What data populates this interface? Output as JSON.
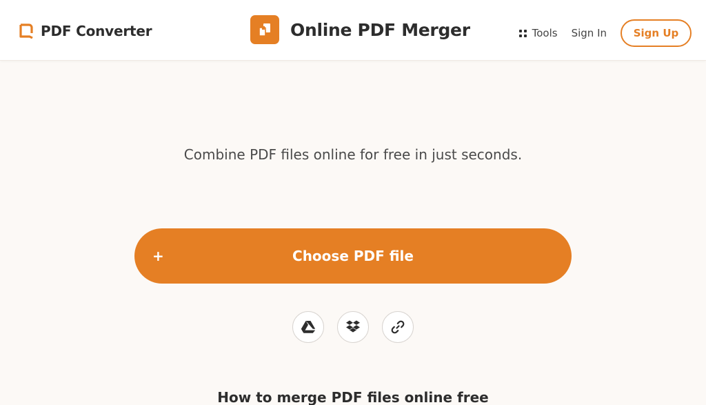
{
  "header": {
    "brand_name": "PDF Converter",
    "page_title": "Online PDF Merger",
    "nav": {
      "tools_label": "Tools",
      "signin_label": "Sign In",
      "signup_label": "Sign Up"
    }
  },
  "main": {
    "subtitle": "Combine PDF files online for free in just seconds.",
    "choose_button_label": "Choose PDF file",
    "choose_button_prefix": "+",
    "sources": [
      {
        "name": "google-drive",
        "icon": "google-drive-icon"
      },
      {
        "name": "dropbox",
        "icon": "dropbox-icon"
      },
      {
        "name": "url-link",
        "icon": "link-icon"
      }
    ],
    "how_to_heading": "How to merge PDF files online free"
  },
  "colors": {
    "accent": "#e57f24",
    "background": "#fcf9f6",
    "header_bg": "#ffffff",
    "text_dark": "#2d2d2d"
  }
}
